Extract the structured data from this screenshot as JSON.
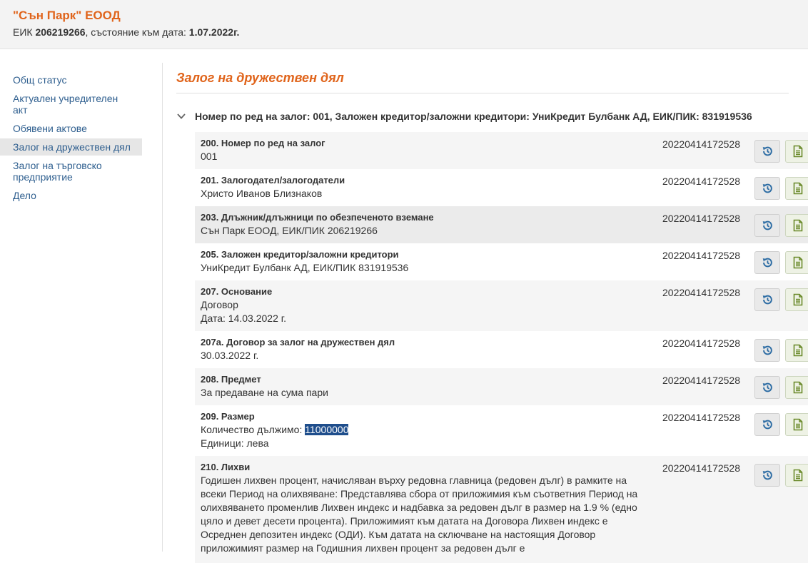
{
  "header": {
    "company_name": "\"Сън Парк\" ЕООД",
    "eik_label": "ЕИК ",
    "eik_value": "206219266",
    "state_label": ", състояние към дата: ",
    "state_date": "1.07.2022г."
  },
  "sidebar": {
    "items": [
      {
        "label": "Общ статус"
      },
      {
        "label": "Актуален учредителен акт"
      },
      {
        "label": "Обявени актове"
      },
      {
        "label": "Залог на дружествен дял"
      },
      {
        "label": "Залог на търговско предприятие"
      },
      {
        "label": "Дело"
      }
    ],
    "active_index": 3
  },
  "main": {
    "section_title": "Залог на дружествен дял",
    "group_title": "Номер по ред на залог: 001, Заложен кредитор/заложни кредитори: УниКредит Булбанк АД, ЕИК/ПИК: 831919536"
  },
  "rows": [
    {
      "label": "200. Номер по ред на залог",
      "lines": [
        "001"
      ],
      "id": "20220414172528"
    },
    {
      "label": "201. Залогодател/залогодатели",
      "lines": [
        "Христо Иванов Близнаков"
      ],
      "id": "20220414172528"
    },
    {
      "label": "203. Длъжник/длъжници по обезпеченото вземане",
      "lines": [
        "Сън Парк ЕООД, ЕИК/ПИК 206219266"
      ],
      "id": "20220414172528"
    },
    {
      "label": "205. Заложен кредитор/заложни кредитори",
      "lines": [
        "УниКредит Булбанк АД, ЕИК/ПИК 831919536"
      ],
      "id": "20220414172528"
    },
    {
      "label": "207. Основание",
      "lines": [
        "Договор",
        "Дата: 14.03.2022 г."
      ],
      "id": "20220414172528"
    },
    {
      "label": "207а. Договор за залог на дружествен дял",
      "lines": [
        "30.03.2022 г."
      ],
      "id": "20220414172528"
    },
    {
      "label": "208. Предмет",
      "lines": [
        "За предаване на сума пари"
      ],
      "id": "20220414172528"
    },
    {
      "label": "209. Размер",
      "amount_prefix": "Количество дължимо: ",
      "amount_value": "11000000",
      "lines": [
        "Единици: лева"
      ],
      "id": "20220414172528"
    },
    {
      "label": "210. Лихви",
      "lines": [
        "Годишен лихвен процент, начисляван върху редовна главница (редовен дълг) в рамките на всеки Период на олихвяване: Представлява сбора от приложимия към съответния Период на олихвяването променлив Лихвен индекс и надбавка за редовен дълг в размер на 1.9 % (едно цяло и девет десети процента). Приложимият към датата на Договора Лихвен индекс е Осреднен депозитен индекс (ОДИ). Към датата на сключване на настоящия Договор приложимият размер на Годишния лихвен процент за редовен дълг е"
      ],
      "id": "20220414172528"
    }
  ],
  "icons": {
    "history": "history-icon",
    "document": "document-icon",
    "chevron": "chevron-down-icon"
  },
  "colors": {
    "accent": "#e0641b",
    "link": "#2f5f8f",
    "icon_blue": "#2e6da4",
    "icon_green": "#6a8a2a"
  }
}
